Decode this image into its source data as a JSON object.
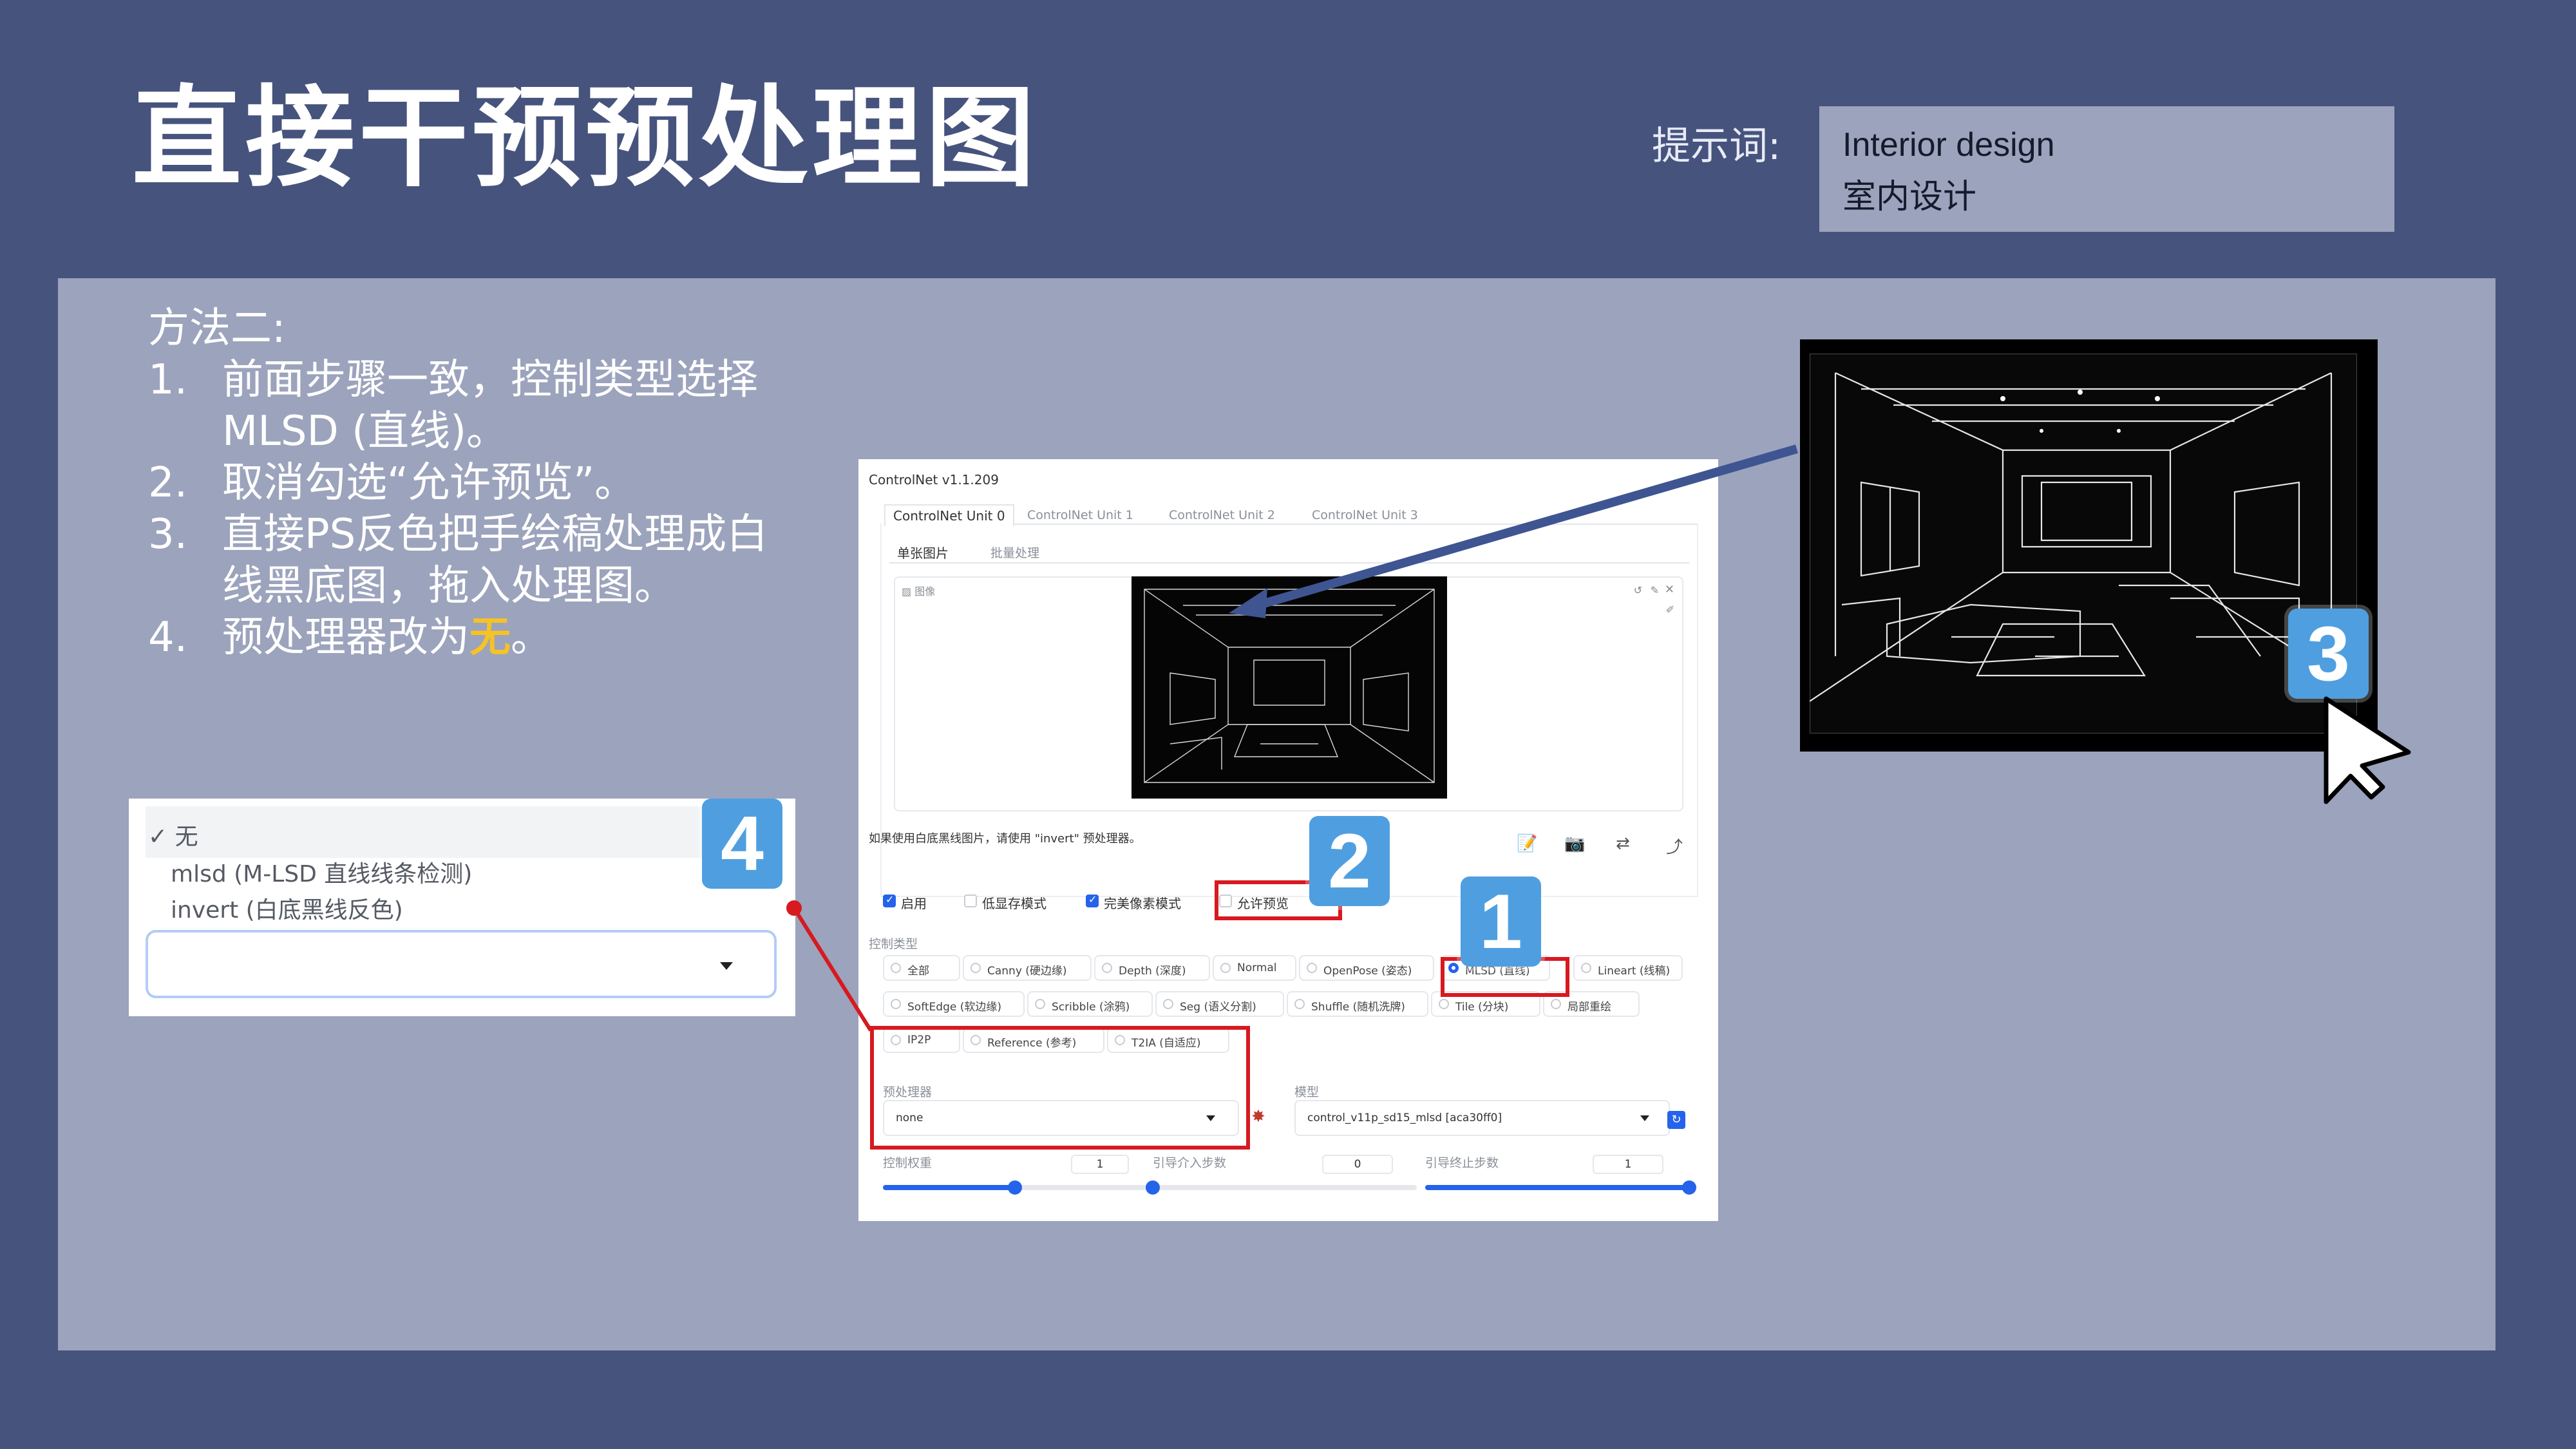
{
  "slide": {
    "title": "直接干预预处理图",
    "prompt_label": "提示词:",
    "prompt_en": "Interior design",
    "prompt_zh": "室内设计"
  },
  "instructions": {
    "heading": "方法二:",
    "steps": [
      {
        "num": "1.",
        "line1": "前面步骤一致，控制类型选择",
        "line2": "MLSD (直线)。"
      },
      {
        "num": "2.",
        "line1": "取消勾选“允许预览”。"
      },
      {
        "num": "3.",
        "line1": "直接PS反色把手绘稿处理成白",
        "line2": "线黑底图，拖入处理图。"
      },
      {
        "num": "4.",
        "line1_prefix": "预处理器改为",
        "line1_highlight": "无",
        "line1_suffix": "。"
      }
    ]
  },
  "dropdown_crop": {
    "options": [
      "✓ 无",
      "mlsd (M-LSD 直线线条检测)",
      "invert (白底黑线反色)"
    ]
  },
  "badges": [
    "1",
    "2",
    "3",
    "4"
  ],
  "controlnet": {
    "header": "ControlNet v1.1.209",
    "unit_tabs": [
      "ControlNet Unit 0",
      "ControlNet Unit 1",
      "ControlNet Unit 2",
      "ControlNet Unit 3"
    ],
    "image_tabs": [
      "单张图片",
      "批量处理"
    ],
    "image_label": "图像",
    "hint": "如果使用白底黑线图片，请使用 \"invert\" 预处理器。",
    "checkboxes": [
      {
        "label": "启用",
        "checked": true
      },
      {
        "label": "低显存模式",
        "checked": false
      },
      {
        "label": "完美像素模式",
        "checked": true
      },
      {
        "label": "允许预览",
        "checked": false
      }
    ],
    "control_type_label": "控制类型",
    "control_types": [
      {
        "label": "全部",
        "selected": false
      },
      {
        "label": "Canny (硬边缘)",
        "selected": false
      },
      {
        "label": "Depth (深度)",
        "selected": false
      },
      {
        "label": "Normal",
        "selected": false
      },
      {
        "label": "OpenPose (姿态)",
        "selected": false
      },
      {
        "label": "MLSD (直线)",
        "selected": true
      },
      {
        "label": "Lineart (线稿)",
        "selected": false
      },
      {
        "label": "SoftEdge (软边缘)",
        "selected": false
      },
      {
        "label": "Scribble (涂鸦)",
        "selected": false
      },
      {
        "label": "Seg (语义分割)",
        "selected": false
      },
      {
        "label": "Shuffle (随机洗牌)",
        "selected": false
      },
      {
        "label": "Tile (分块)",
        "selected": false
      },
      {
        "label": "局部重绘",
        "selected": false
      },
      {
        "label": "IP2P",
        "selected": false
      },
      {
        "label": "Reference (参考)",
        "selected": false
      },
      {
        "label": "T2IA (自适应)",
        "selected": false
      }
    ],
    "preprocessor_label": "预处理器",
    "preprocessor_value": "none",
    "model_label": "模型",
    "model_value": "control_v11p_sd15_mlsd [aca30ff0]",
    "sliders": [
      {
        "label": "控制权重",
        "value": "1",
        "fraction": 0.5
      },
      {
        "label": "引导介入步数",
        "value": "0",
        "fraction": 0.0
      },
      {
        "label": "引导终止步数",
        "value": "1",
        "fraction": 1.0
      }
    ]
  }
}
